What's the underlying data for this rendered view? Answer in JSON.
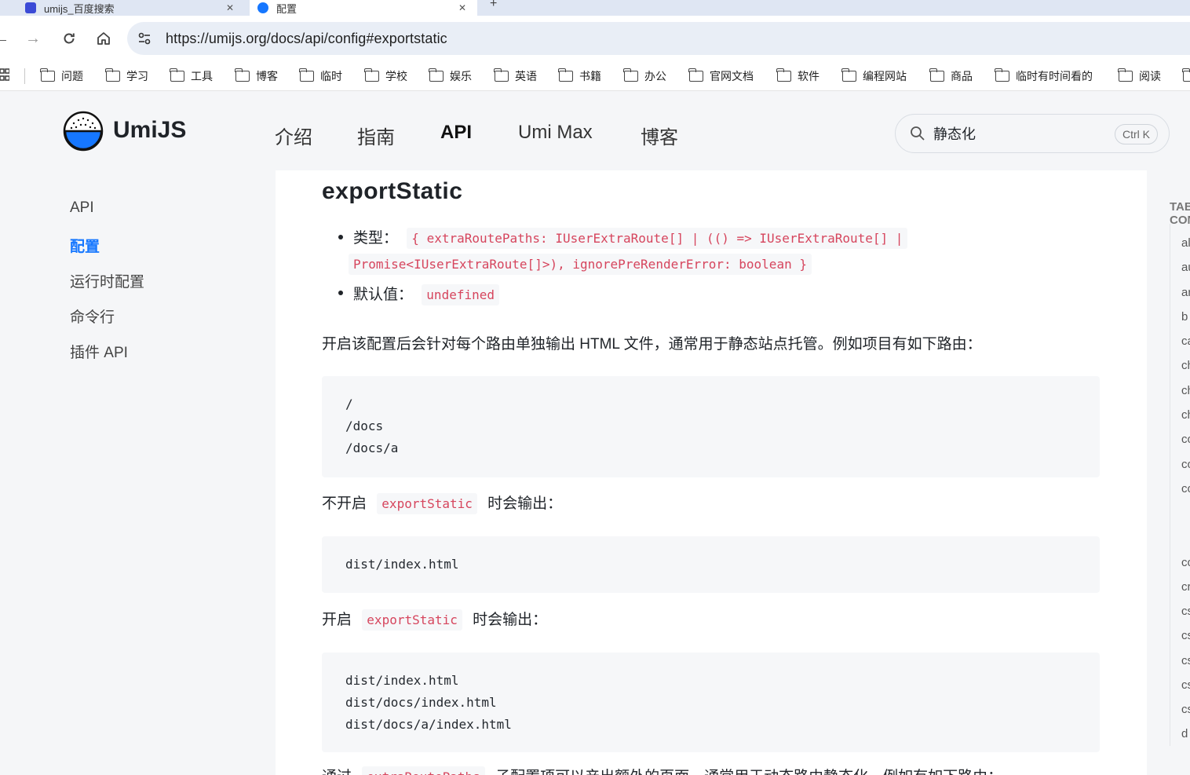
{
  "browser": {
    "tabs": [
      {
        "title": "umijs_百度搜索",
        "active": false
      },
      {
        "title": "配置",
        "active": true
      }
    ],
    "url": "https://umijs.org/docs/api/config#exportstatic",
    "bookmarks": [
      "问题",
      "学习",
      "工具",
      "博客",
      "临时",
      "学校",
      "娱乐",
      "英语",
      "书籍",
      "办公",
      "官网文档",
      "软件",
      "编程网站",
      "商品",
      "临时有时间看的",
      "阅读"
    ]
  },
  "site": {
    "brand": "UmiJS",
    "nav": [
      "介绍",
      "指南",
      "API",
      "Umi Max",
      "博客"
    ],
    "nav_active": "API",
    "search": {
      "value": "静态化",
      "shortcut": "Ctrl K"
    }
  },
  "sidebar": {
    "items": [
      "API",
      "配置",
      "运行时配置",
      "命令行",
      "插件 API"
    ],
    "active": "配置"
  },
  "content": {
    "heading": "exportStatic",
    "type_label": "类型：",
    "type_code_line1": "{ extraRoutePaths: IUserExtraRoute[] | (() => IUserExtraRoute[] |",
    "type_code_line2": "Promise<IUserExtraRoute[]>), ignorePreRenderError: boolean }",
    "default_label": "默认值：",
    "default_code": "undefined",
    "para1": "开启该配置后会针对每个路由单独输出 HTML 文件，通常用于静态站点托管。例如项目有如下路由：",
    "code1": "/\n/docs\n/docs/a",
    "para2_before": "不开启",
    "para2_code": "exportStatic",
    "para2_after": "时会输出：",
    "code2": "dist/index.html",
    "para3_before": "开启",
    "para3_code": "exportStatic",
    "para3_after": "时会输出：",
    "code3": "dist/index.html\ndist/docs/index.html\ndist/docs/a/index.html",
    "para4_before": "通过",
    "para4_code": "extraRoutePaths",
    "para4_after": "子配置项可以产出额外的页面，通常用于动态路由静态化。例如有如下路由："
  },
  "toc": {
    "title": "TABLE OF CONTENTS",
    "items": [
      "al",
      "au",
      "ar",
      "b",
      "ca",
      "ch",
      "ch",
      "ch",
      "co",
      "co",
      "co",
      "co",
      "cr",
      "cs",
      "cs",
      "cs",
      "cs",
      "cs",
      "d"
    ]
  },
  "colors": {
    "accent": "#1677ff",
    "code_red": "#d6455d"
  }
}
